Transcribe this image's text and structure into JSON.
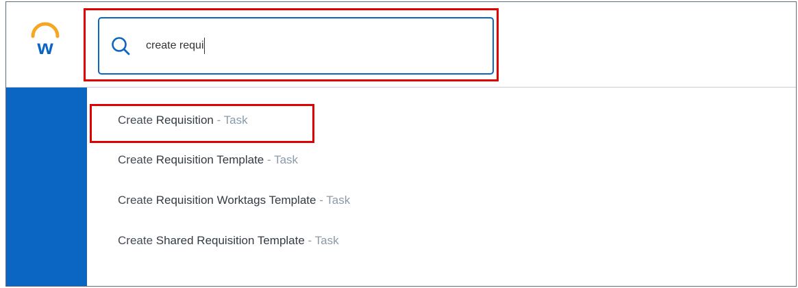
{
  "search": {
    "query": "create requi",
    "placeholder": ""
  },
  "results": [
    {
      "prefix": "Create ",
      "match": "Requisition",
      "suffix": "",
      "separator": " - ",
      "type": "Task"
    },
    {
      "prefix": "Create ",
      "match": "Requisition",
      "suffix": " Template",
      "separator": " - ",
      "type": "Task"
    },
    {
      "prefix": "Create ",
      "match": "Requisition",
      "suffix": " Worktags Template",
      "separator": " - ",
      "type": "Task"
    },
    {
      "prefix": "Create ",
      "match": "Shared Requisition",
      "suffix": " Template",
      "separator": " - ",
      "type": "Task"
    }
  ],
  "colors": {
    "brand_blue": "#0b65c2",
    "logo_orange": "#f5a623",
    "highlight_red": "#e00000"
  },
  "icons": {
    "logo": "workday-logo-icon",
    "search": "search-icon"
  }
}
